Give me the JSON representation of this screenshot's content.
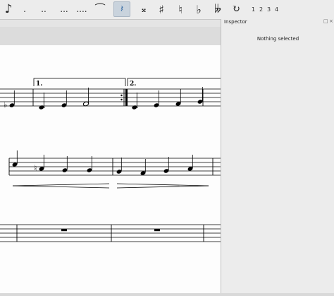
{
  "toolbar": {
    "items": [
      {
        "name": "eighth-note-icon",
        "glyph": "♪"
      },
      {
        "name": "dot-icon",
        "glyph": "."
      },
      {
        "name": "double-dot-icon",
        "glyph": ".."
      },
      {
        "name": "triple-dot-icon",
        "glyph": "..."
      },
      {
        "name": "quadruple-dot-icon",
        "glyph": "...."
      },
      {
        "name": "tie-icon",
        "glyph": "⁀"
      },
      {
        "name": "rest-icon",
        "glyph": "𝄽"
      },
      {
        "name": "double-sharp-icon",
        "glyph": "𝄪"
      },
      {
        "name": "sharp-icon",
        "glyph": "♯"
      },
      {
        "name": "natural-icon",
        "glyph": "♮"
      },
      {
        "name": "flat-icon",
        "glyph": "♭"
      },
      {
        "name": "double-flat-icon",
        "glyph": "𝄫"
      },
      {
        "name": "flip-direction-icon",
        "glyph": "↻"
      }
    ],
    "voices": [
      "1",
      "2",
      "3",
      "4"
    ]
  },
  "inspector": {
    "title": "Inspector",
    "message": "Nothing selected",
    "float_glyph": "□",
    "close_glyph": "×"
  },
  "score": {
    "volta_1": "1.",
    "volta_2": "2."
  }
}
